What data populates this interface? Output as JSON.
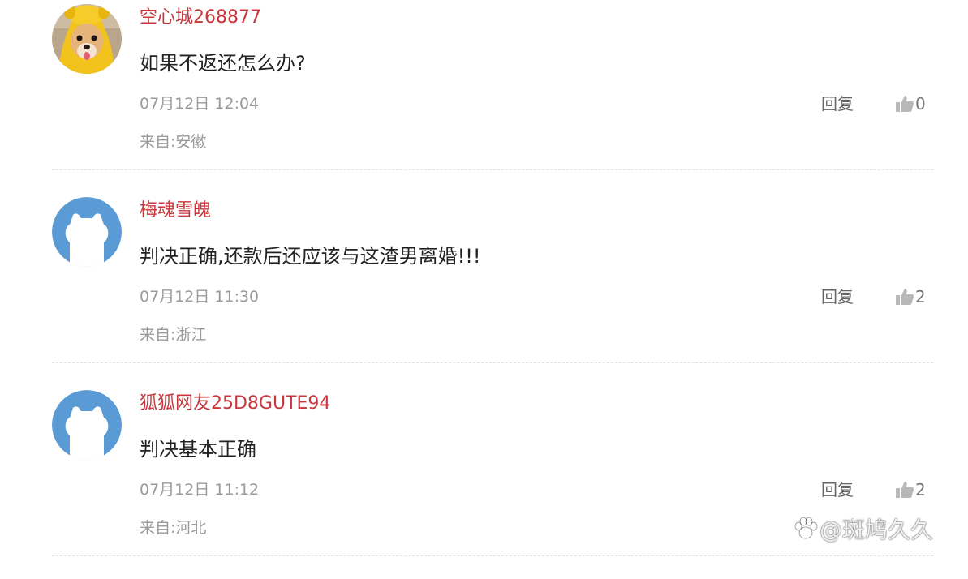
{
  "comments": [
    {
      "username": "空心城268877",
      "content": "如果不返还怎么办?",
      "time": "07月12日 12:04",
      "location": "来自:安徽",
      "reply_label": "回复",
      "likes": "0",
      "avatar_icon": "dog-photo-avatar"
    },
    {
      "username": "梅魂雪魄",
      "content": "判决正确,还款后还应该与这渣男离婚!!!",
      "time": "07月12日 11:30",
      "location": "来自:浙江",
      "reply_label": "回复",
      "likes": "2",
      "avatar_icon": "default-user-avatar"
    },
    {
      "username": "狐狐网友25D8GUTE94",
      "content": "判决基本正确",
      "time": "07月12日 11:12",
      "location": "来自:河北",
      "reply_label": "回复",
      "likes": "2",
      "avatar_icon": "default-user-avatar"
    }
  ],
  "watermark": {
    "text": "@斑鸠久久",
    "icon": "paw-icon"
  },
  "colors": {
    "username": "#c8373d",
    "content": "#222222",
    "meta": "#9a9a9a",
    "avatar_blue": "#5b9bd5",
    "divider": "#e2e2e2"
  }
}
